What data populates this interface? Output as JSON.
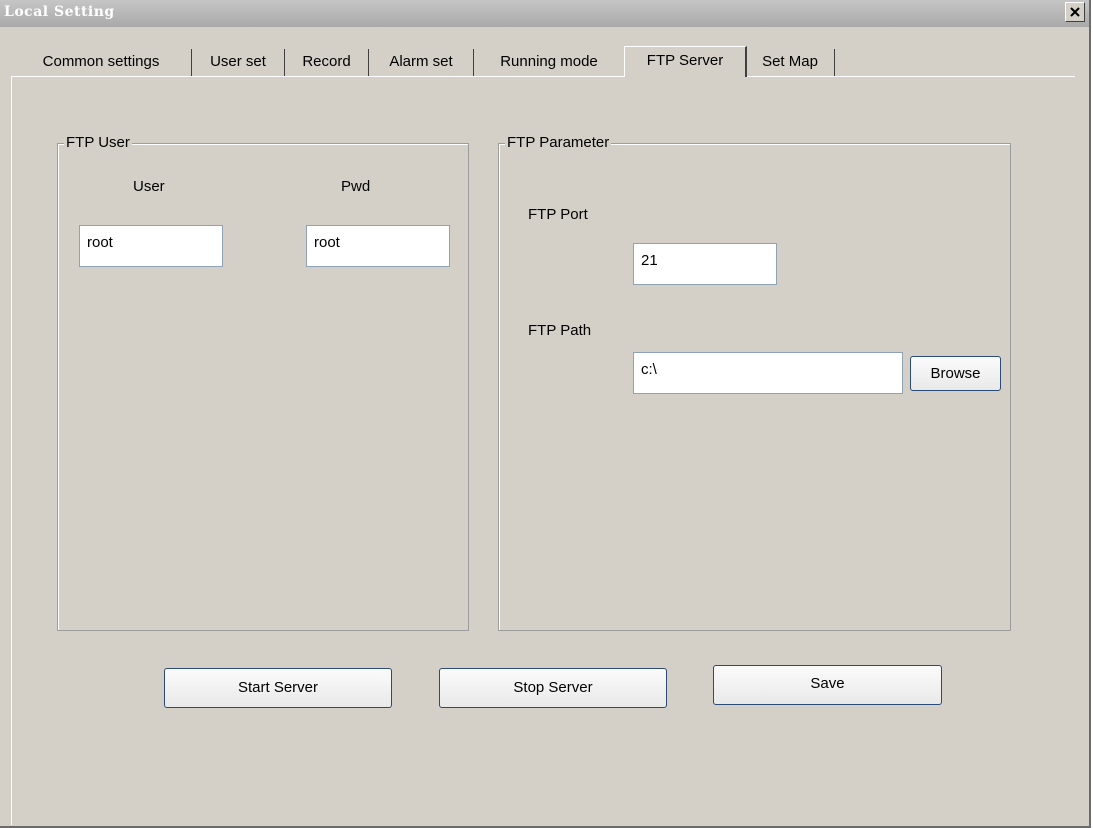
{
  "window": {
    "title": "Local Setting"
  },
  "tabs": [
    {
      "label": "Common settings"
    },
    {
      "label": "User set"
    },
    {
      "label": "Record"
    },
    {
      "label": "Alarm set"
    },
    {
      "label": "Running mode"
    },
    {
      "label": "FTP Server",
      "active": true
    },
    {
      "label": "Set Map"
    }
  ],
  "ftp_user": {
    "legend": "FTP User",
    "user_label": "User",
    "pwd_label": "Pwd",
    "user_value": "root",
    "pwd_value": "root"
  },
  "ftp_param": {
    "legend": "FTP Parameter",
    "port_label": "FTP Port",
    "port_value": "21",
    "path_label": "FTP Path",
    "path_value": "c:\\",
    "browse_label": "Browse"
  },
  "actions": {
    "start": "Start Server",
    "stop": "Stop Server",
    "save": "Save"
  },
  "icons": {
    "close": "close-icon"
  },
  "colors": {
    "face": "#d4d0c8",
    "title_bar": "#b0b0b0",
    "button_border": "#2a4a78"
  }
}
